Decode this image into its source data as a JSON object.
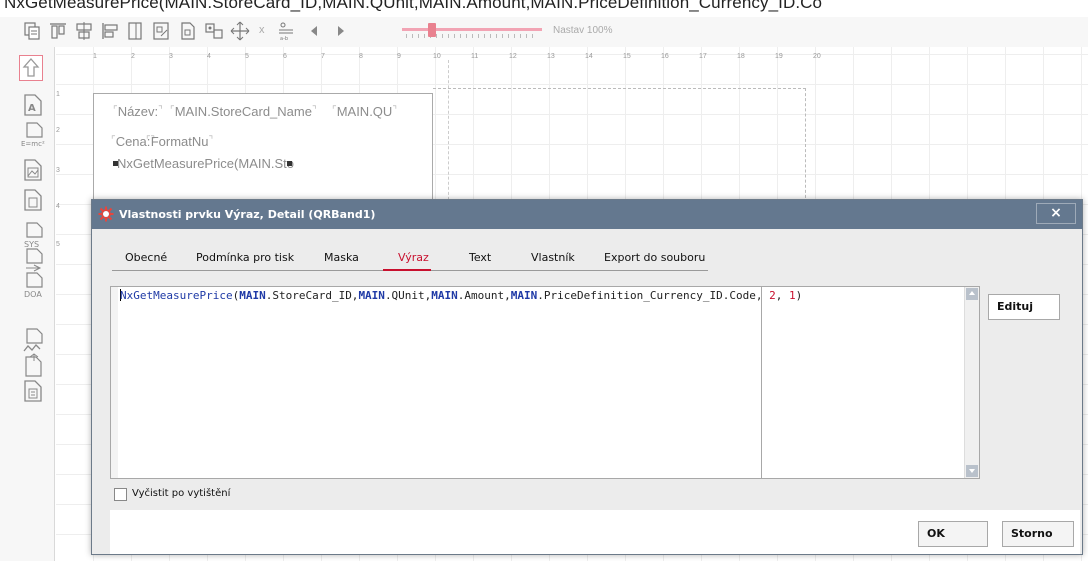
{
  "top_cutoff_text": "NxGetMeasurePrice(MAIN.StoreCard_ID,MAIN.QUnit,MAIN.Amount,MAIN.PriceDefinition_Currency_ID.Co",
  "toolbar": {
    "zoom_label": "Nastav 100%",
    "x_label": "x",
    "icons": [
      "align-left-icon",
      "align-top-icon",
      "align-center-icon",
      "align-right-icon",
      "bring-front-icon",
      "send-back-icon",
      "same-width-icon",
      "same-height-icon",
      "space-icon",
      "grid-icon",
      "prev-icon",
      "next-icon"
    ]
  },
  "left_tools": {
    "icons": [
      "pointer-up-icon",
      "label-icon",
      "expression-icon",
      "image-icon",
      "shape-icon",
      "sysdata-icon",
      "richtext-icon",
      "barcode-icon",
      "chart-icon",
      "subreport-icon",
      "memo-icon"
    ]
  },
  "ruler": {
    "h_ticks": [
      "1",
      "2",
      "3",
      "4",
      "5",
      "6",
      "7",
      "8",
      "9",
      "10",
      "11",
      "12",
      "13",
      "14",
      "15",
      "16",
      "17",
      "18",
      "19",
      "20"
    ],
    "v_ticks": [
      "1",
      "2",
      "3",
      "4",
      "5"
    ]
  },
  "designer": {
    "controls": [
      {
        "id": "nazev_label",
        "text": "Název:"
      },
      {
        "id": "storecard_name",
        "text": "MAIN.StoreCard_Name"
      },
      {
        "id": "qunit",
        "text": "MAIN.QU"
      },
      {
        "id": "cena_label",
        "text": "Cena:"
      },
      {
        "id": "formatnu",
        "text": "FormatNu"
      },
      {
        "id": "nxgetmeasure",
        "text": "NxGetMeasurePrice(MAIN.Sto"
      }
    ]
  },
  "dialog": {
    "title": "Vlastnosti prvku Výraz, Detail (QRBand1)",
    "close_label": "×",
    "tabs": [
      {
        "label": "Obecné",
        "active": false
      },
      {
        "label": "Podmínka pro tisk",
        "active": false
      },
      {
        "label": "Maska",
        "active": false
      },
      {
        "label": "Výraz",
        "active": true
      },
      {
        "label": "Text",
        "active": false
      },
      {
        "label": "Vlastník",
        "active": false
      },
      {
        "label": "Export do souboru",
        "active": false
      }
    ],
    "expression": {
      "fn": "NxGetMeasurePrice",
      "open": "(",
      "parts": [
        {
          "kw": "MAIN",
          "rest": ".StoreCard_ID,"
        },
        {
          "kw": "MAIN",
          "rest": ".QUnit,"
        },
        {
          "kw": "MAIN",
          "rest": ".Amount,"
        },
        {
          "kw": "MAIN",
          "rest": ".PriceDefinition_Currency_ID.Code, "
        }
      ],
      "arg1": "2",
      "sep": ", ",
      "arg2": "1",
      "close": ")"
    },
    "edit_button": "Edituj",
    "checkbox_label": "Vyčistit po vytištění",
    "ok_button": "OK",
    "cancel_button": "Storno"
  },
  "colors": {
    "accent": "#c8102e",
    "titlebar": "#64788f",
    "zoom_track": "#f2a4b4"
  }
}
